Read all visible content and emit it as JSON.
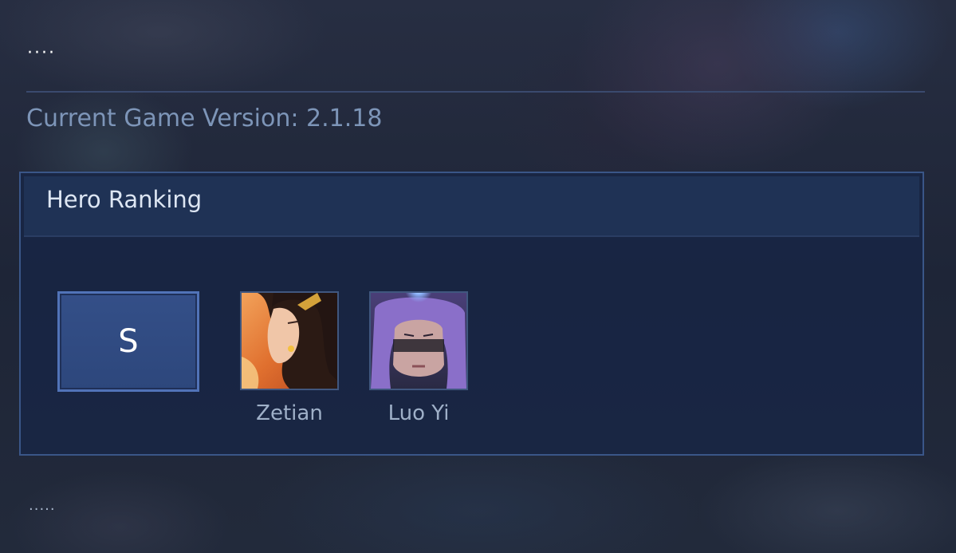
{
  "header": {
    "menu_dots": "····",
    "version_text": "Current Game Version: 2.1.18"
  },
  "panel": {
    "title": "Hero Ranking",
    "tiers": [
      {
        "label": "S",
        "heroes": [
          {
            "name": "Zetian",
            "icon": "zetian-portrait"
          },
          {
            "name": "Luo Yi",
            "icon": "luo-yi-portrait"
          }
        ]
      }
    ]
  },
  "footer": {
    "loading_dots": "·····"
  },
  "colors": {
    "version_text": "#7d95b8",
    "panel_border": "#3a5688",
    "tier_border": "#5173b8",
    "hero_name": "#9fb0c8"
  }
}
